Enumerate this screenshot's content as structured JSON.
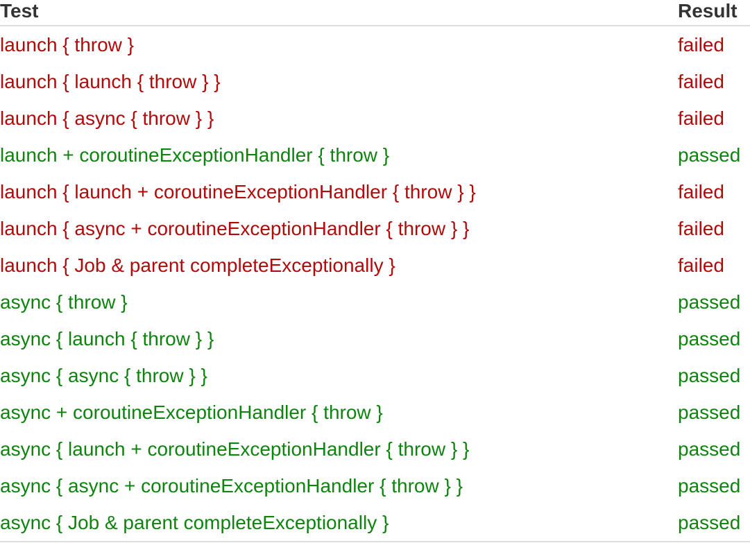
{
  "table": {
    "headers": {
      "test": "Test",
      "result": "Result"
    },
    "colors": {
      "failed": "#b10a0a",
      "passed": "#0e830e"
    },
    "rows": [
      {
        "test": "launch { throw }",
        "result": "failed"
      },
      {
        "test": "launch { launch { throw } }",
        "result": "failed"
      },
      {
        "test": "launch { async { throw } }",
        "result": "failed"
      },
      {
        "test": "launch + coroutineExceptionHandler { throw }",
        "result": "passed"
      },
      {
        "test": "launch { launch + coroutineExceptionHandler { throw } }",
        "result": "failed"
      },
      {
        "test": "launch { async + coroutineExceptionHandler { throw } }",
        "result": "failed"
      },
      {
        "test": "launch { Job & parent completeExceptionally }",
        "result": "failed"
      },
      {
        "test": "async { throw }",
        "result": "passed"
      },
      {
        "test": "async { launch { throw } }",
        "result": "passed"
      },
      {
        "test": "async { async { throw } }",
        "result": "passed"
      },
      {
        "test": "async + coroutineExceptionHandler { throw }",
        "result": "passed"
      },
      {
        "test": "async { launch + coroutineExceptionHandler { throw } }",
        "result": "passed"
      },
      {
        "test": "async { async + coroutineExceptionHandler { throw } }",
        "result": "passed"
      },
      {
        "test": "async { Job & parent completeExceptionally }",
        "result": "passed"
      }
    ]
  }
}
